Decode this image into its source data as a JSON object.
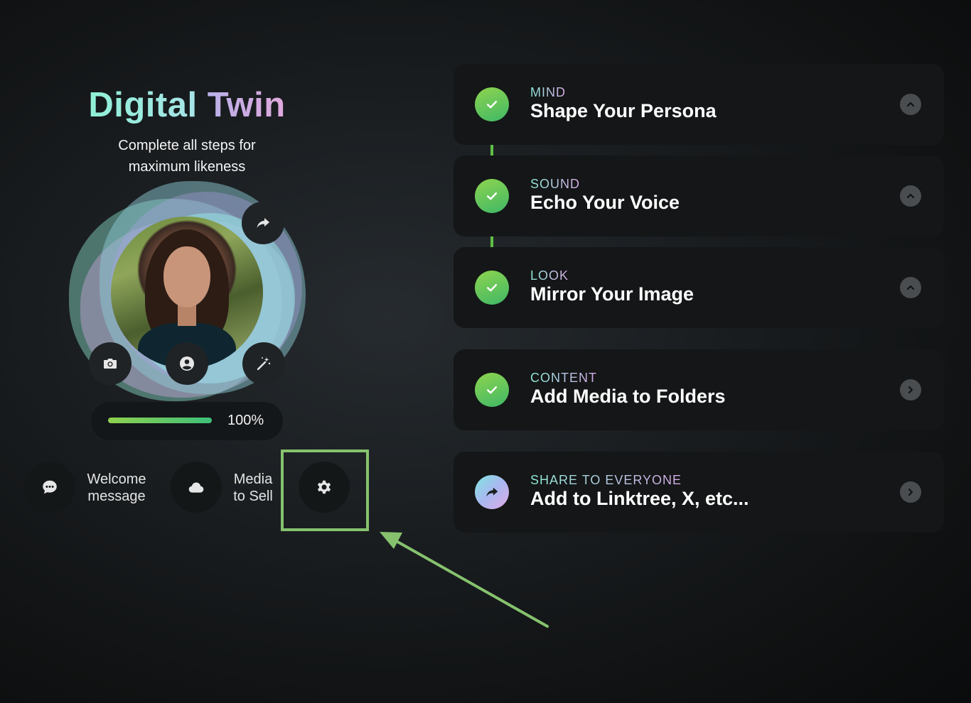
{
  "hero": {
    "title_word1": "Digital",
    "title_word2": "Twin",
    "subtitle_line1": "Complete all steps for",
    "subtitle_line2": "maximum likeness"
  },
  "avatar": {
    "buttons": [
      "share-icon",
      "camera-icon",
      "user-icon",
      "magic-wand-icon"
    ]
  },
  "progress": {
    "value": 1.0,
    "label": "100%"
  },
  "quick_actions": [
    {
      "icon": "chat-bubble-icon",
      "label_line1": "Welcome",
      "label_line2": "message"
    },
    {
      "icon": "cloud-icon",
      "label_line1": "Media",
      "label_line2": "to Sell"
    },
    {
      "icon": "gear-icon",
      "label_line1": "",
      "label_line2": ""
    }
  ],
  "steps": [
    {
      "kicker": "MIND",
      "heading": "Shape Your Persona",
      "status": "complete",
      "chevron": "chevron-up-icon"
    },
    {
      "kicker": "SOUND",
      "heading": "Echo Your Voice",
      "status": "complete",
      "chevron": "chevron-up-icon"
    },
    {
      "kicker": "LOOK",
      "heading": "Mirror Your Image",
      "status": "complete",
      "chevron": "chevron-up-icon"
    },
    {
      "kicker": "CONTENT",
      "heading": "Add Media to Folders",
      "status": "complete",
      "chevron": "chevron-right-icon"
    },
    {
      "kicker": "SHARE TO EVERYONE",
      "heading": "Add to Linktree, X, etc...",
      "status": "share",
      "chevron": "chevron-right-icon"
    }
  ],
  "colors": {
    "accent_green": "#5fbf45",
    "highlight_green": "#86c26e",
    "card_bg": "#141617"
  }
}
